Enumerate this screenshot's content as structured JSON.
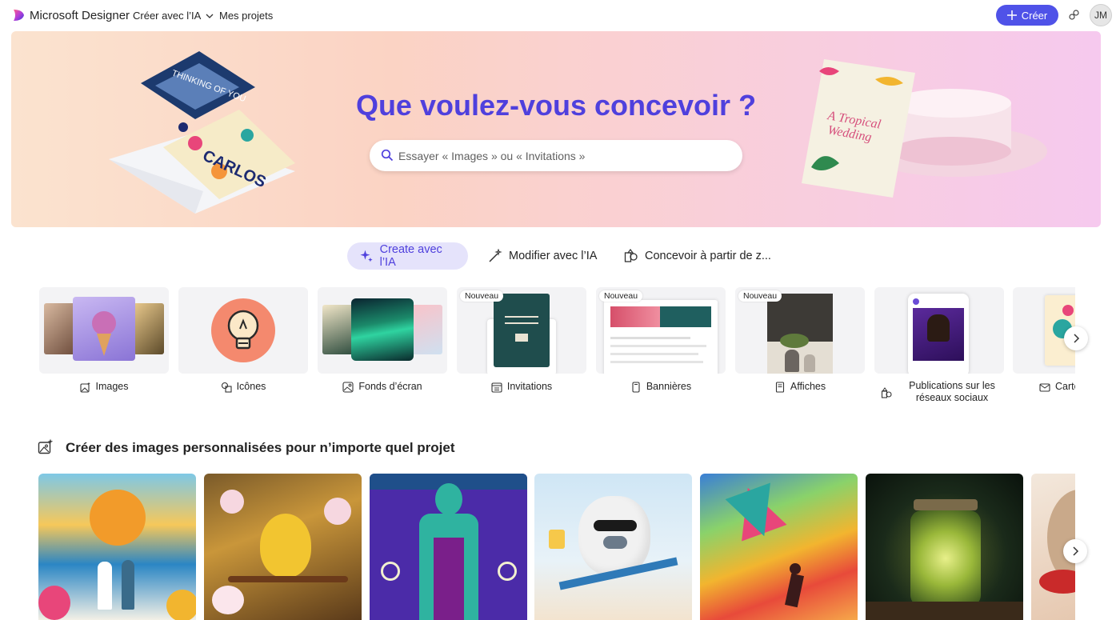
{
  "header": {
    "brand": "Microsoft Designer",
    "nav_ai": "Créer avec l’IA",
    "nav_projects": "Mes projets",
    "create_label": "Créer",
    "avatar_initials": "JM"
  },
  "hero": {
    "title": "Que voulez-vous concevoir ?",
    "search_placeholder": "Essayer « Images » ou « Invitations »"
  },
  "tabs": [
    {
      "label": "Create avec l’IA",
      "active": true,
      "icon": "sparkle-icon"
    },
    {
      "label": "Modifier avec l’IA",
      "active": false,
      "icon": "magic-wand-icon"
    },
    {
      "label": "Concevoir à partir de z...",
      "active": false,
      "icon": "shapes-icon"
    }
  ],
  "categories": [
    {
      "label": "Images",
      "icon": "image-sparkle-icon",
      "badge": ""
    },
    {
      "label": "Icônes",
      "icon": "icon-shapes-icon",
      "badge": ""
    },
    {
      "label": "Fonds d’écran",
      "icon": "wallpaper-icon",
      "badge": ""
    },
    {
      "label": "Invitations",
      "icon": "calendar-icon",
      "badge": "Nouveau"
    },
    {
      "label": "Bannières",
      "icon": "banner-icon",
      "badge": "Nouveau"
    },
    {
      "label": "Affiches",
      "icon": "poster-icon",
      "badge": "Nouveau"
    },
    {
      "label": "Publications sur les réseaux sociaux",
      "icon": "social-post-icon",
      "badge": ""
    },
    {
      "label": "Carte",
      "icon": "envelope-icon",
      "badge": ""
    }
  ],
  "section": {
    "title": "Créer des images personnalisées pour n’importe quel projet"
  },
  "colors": {
    "accent": "#4f52e8",
    "title_purple": "#4f40dd",
    "active_tab_bg": "#e5e3fb"
  }
}
